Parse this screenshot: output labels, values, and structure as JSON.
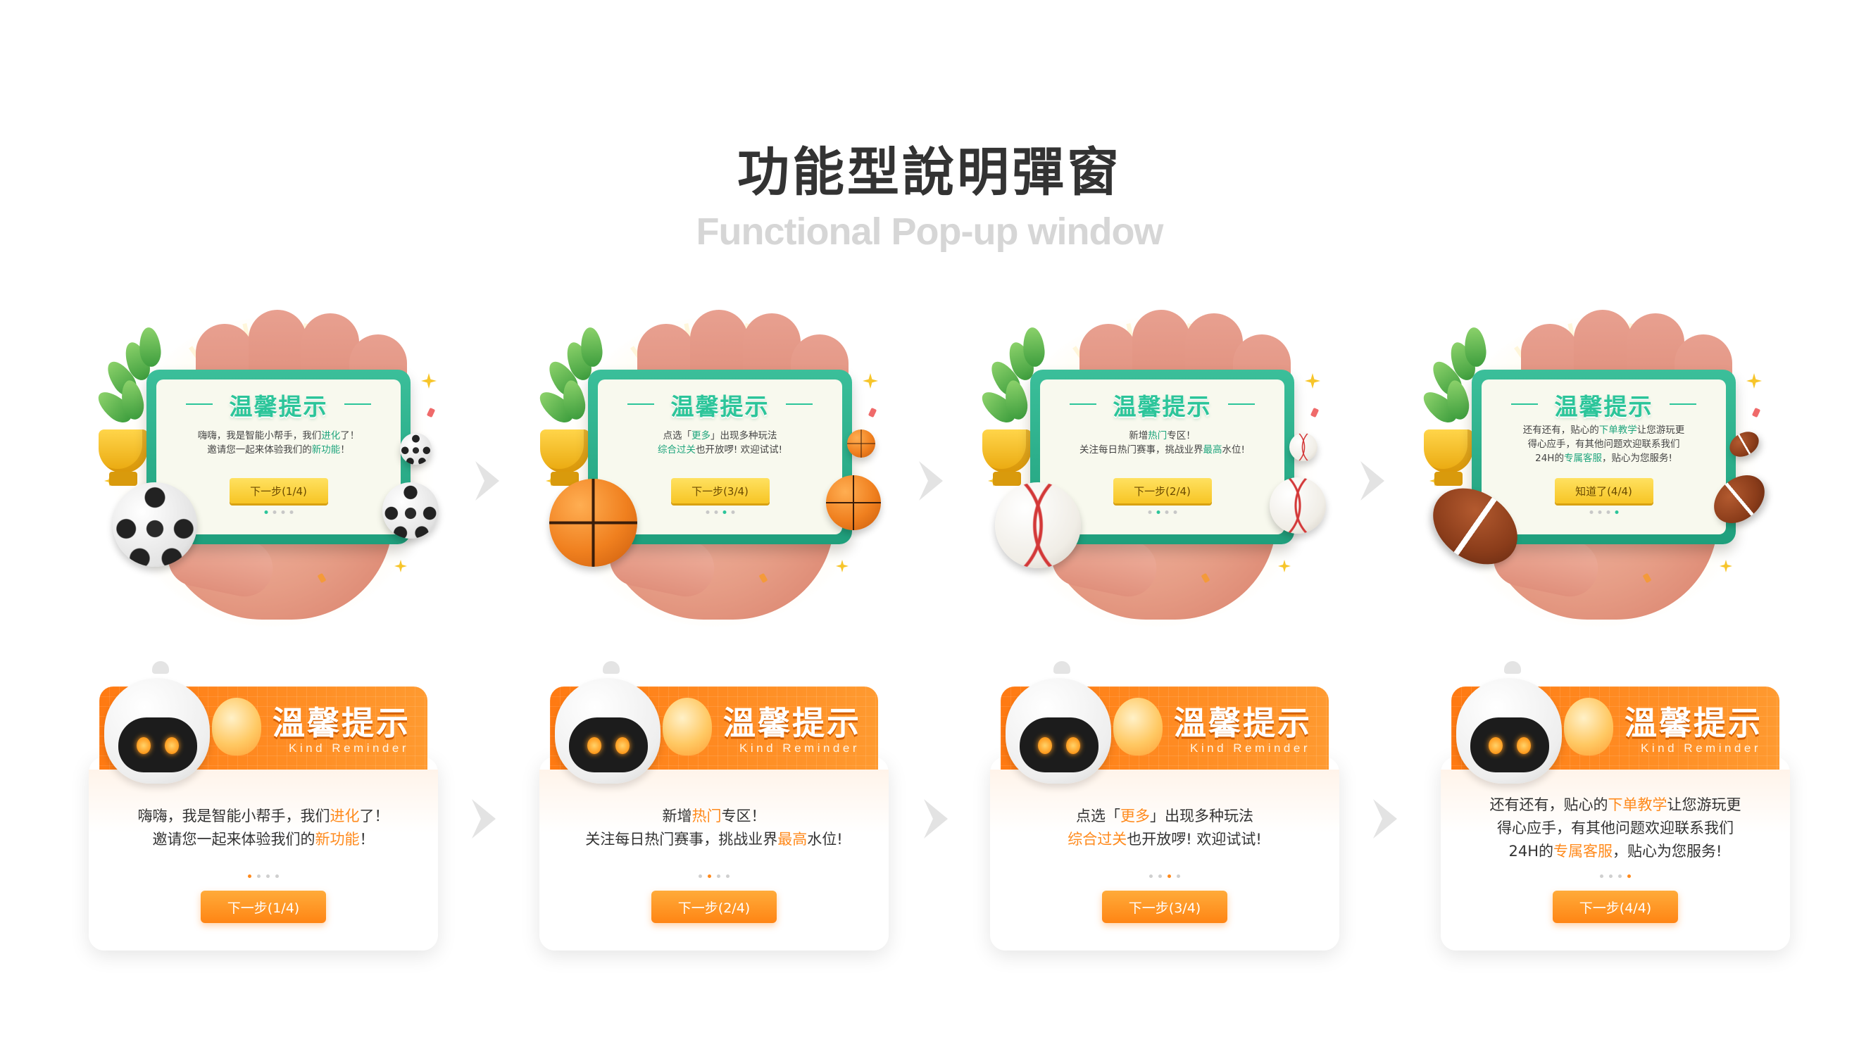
{
  "header": {
    "title": "功能型說明彈窗",
    "subtitle": "Functional Pop-up window"
  },
  "illustrated_cards": [
    {
      "title": "温馨提示",
      "lines": [
        [
          {
            "t": "嗨嗨，我是智能小帮手，我们"
          },
          {
            "t": "进化",
            "hl": true
          },
          {
            "t": "了！"
          }
        ],
        [
          {
            "t": "邀请您一起来体验我们的"
          },
          {
            "t": "新功能",
            "hl": true
          },
          {
            "t": "！"
          }
        ]
      ],
      "button": "下一步(1/4)",
      "step": 1,
      "ball": "soccer-ball"
    },
    {
      "title": "温馨提示",
      "lines": [
        [
          {
            "t": "点选「"
          },
          {
            "t": "更多",
            "hl": true
          },
          {
            "t": "」出现多种玩法"
          }
        ],
        [
          {
            "t": "综合过关",
            "hl": true
          },
          {
            "t": "也开放啰! 欢迎试试!"
          }
        ]
      ],
      "button": "下一步(3/4)",
      "step": 3,
      "ball": "basketball"
    },
    {
      "title": "温馨提示",
      "lines": [
        [
          {
            "t": "新增"
          },
          {
            "t": "热门",
            "hl": true
          },
          {
            "t": "专区！"
          }
        ],
        [
          {
            "t": "关注每日热门赛事，挑战业界"
          },
          {
            "t": "最高",
            "hl": true
          },
          {
            "t": "水位!"
          }
        ]
      ],
      "button": "下一步(2/4)",
      "step": 2,
      "ball": "baseball"
    },
    {
      "title": "温馨提示",
      "lines": [
        [
          {
            "t": "还有还有，贴心的"
          },
          {
            "t": "下单教学",
            "hl": true
          },
          {
            "t": "让您游玩更"
          }
        ],
        [
          {
            "t": "得心应手，有其他问题欢迎联系我们"
          }
        ],
        [
          {
            "t": "24H的"
          },
          {
            "t": "专属客服",
            "hl": true
          },
          {
            "t": "，贴心为您服务!"
          }
        ]
      ],
      "button": "知道了(4/4)",
      "step": 4,
      "ball": "american-football"
    }
  ],
  "robot_cards": [
    {
      "title": "溫馨提示",
      "subtitle": "Kind Reminder",
      "lines": [
        [
          {
            "t": "嗨嗨，我是智能小帮手，我们"
          },
          {
            "t": "进化",
            "hl": true
          },
          {
            "t": "了！"
          }
        ],
        [
          {
            "t": "邀请您一起来体验我们的"
          },
          {
            "t": "新功能",
            "hl": true
          },
          {
            "t": "！"
          }
        ]
      ],
      "button": "下一步(1/4)",
      "step": 1
    },
    {
      "title": "溫馨提示",
      "subtitle": "Kind Reminder",
      "lines": [
        [
          {
            "t": "新增"
          },
          {
            "t": "热门",
            "hl": true
          },
          {
            "t": "专区！"
          }
        ],
        [
          {
            "t": "关注每日热门赛事，挑战业界"
          },
          {
            "t": "最高",
            "hl": true
          },
          {
            "t": "水位!"
          }
        ]
      ],
      "button": "下一步(2/4)",
      "step": 2
    },
    {
      "title": "溫馨提示",
      "subtitle": "Kind Reminder",
      "lines": [
        [
          {
            "t": "点选「"
          },
          {
            "t": "更多",
            "hl": true
          },
          {
            "t": "」出现多种玩法"
          }
        ],
        [
          {
            "t": "综合过关",
            "hl": true
          },
          {
            "t": "也开放啰! 欢迎试试!"
          }
        ]
      ],
      "button": "下一步(3/4)",
      "step": 3
    },
    {
      "title": "溫馨提示",
      "subtitle": "Kind Reminder",
      "lines": [
        [
          {
            "t": "还有还有，贴心的"
          },
          {
            "t": "下单教学",
            "hl": true
          },
          {
            "t": "让您游玩更"
          }
        ],
        [
          {
            "t": "得心应手，有其他问题欢迎联系我们"
          }
        ],
        [
          {
            "t": "24H的"
          },
          {
            "t": "专属客服",
            "hl": true
          },
          {
            "t": "，贴心为您服务!"
          }
        ]
      ],
      "button": "下一步(4/4)",
      "step": 4
    }
  ],
  "total_steps": 4,
  "colors": {
    "green_accent": "#2cc59a",
    "orange_accent": "#ff8a1c",
    "yellow_button": "#f7c525",
    "arrow": "#e3e3e3"
  }
}
